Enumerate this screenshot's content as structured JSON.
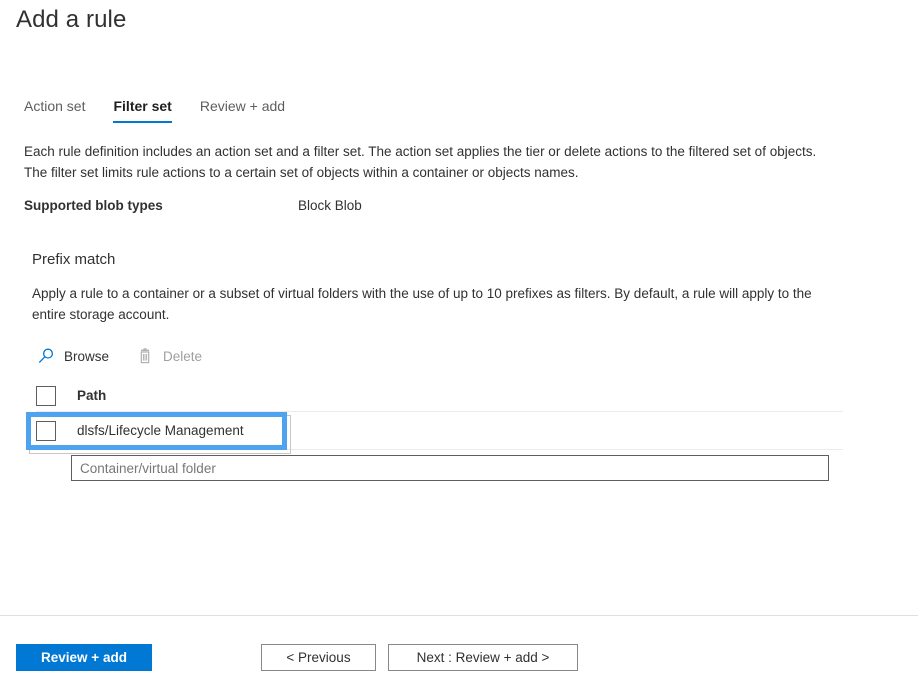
{
  "page": {
    "title": "Add a rule"
  },
  "tabs": [
    {
      "label": "Action set",
      "active": false
    },
    {
      "label": "Filter set",
      "active": true
    },
    {
      "label": "Review + add",
      "active": false
    }
  ],
  "intro": {
    "text": "Each rule definition includes an action set and a filter set. The action set applies the tier or delete actions to the filtered set of objects. The filter set limits rule actions to a certain set of objects within a container or objects names."
  },
  "blob_types": {
    "label": "Supported blob types",
    "value": "Block Blob"
  },
  "prefix_match": {
    "title": "Prefix match",
    "description": "Apply a rule to a container or a subset of virtual folders with the use of up to 10 prefixes as filters. By default, a rule will apply to the entire storage account.",
    "commands": [
      {
        "label": "Browse",
        "icon": "search-icon",
        "disabled": false
      },
      {
        "label": "Delete",
        "icon": "trash-icon",
        "disabled": true
      }
    ],
    "table": {
      "columns": [
        "Path"
      ],
      "rows": [
        {
          "path": "dlsfs/Lifecycle Management",
          "checked": false,
          "highlighted": true
        }
      ]
    },
    "input": {
      "placeholder": "Container/virtual folder",
      "value": ""
    }
  },
  "footer": {
    "primary_button": "Review + add",
    "previous_button": "< Previous",
    "next_button": "Next : Review + add >"
  },
  "colors": {
    "accent": "#0078d4",
    "highlight": "#4ea3f0",
    "text": "#323130",
    "disabled_text": "#a19f9d",
    "divider": "#edebe9"
  }
}
